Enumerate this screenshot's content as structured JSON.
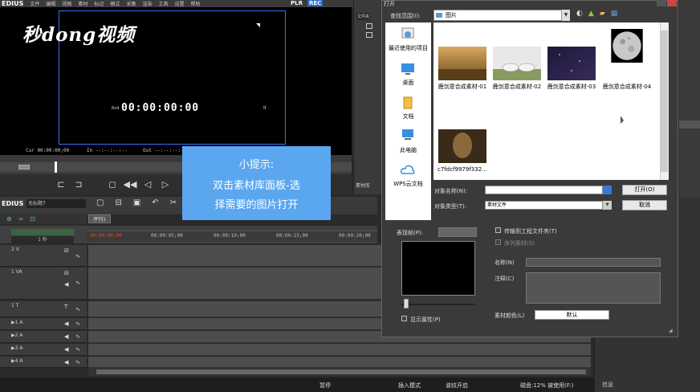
{
  "app": {
    "brand": "EDIUS",
    "menu": [
      "文件",
      "编辑",
      "视图",
      "素材",
      "标记",
      "模式",
      "采集",
      "渲染",
      "工具",
      "设置",
      "帮助"
    ],
    "plr": "PLR",
    "rec": "REC"
  },
  "preview": {
    "logo": "秒dong视频",
    "rec_label": "Rcd",
    "timecode": "00:00:00:00",
    "timecode_suffix": "II",
    "cur": "Cur 00:00:00;00",
    "in": "In --:--:--:--",
    "out": "Out --:--:--:--"
  },
  "bin": {
    "tab": "文件夹",
    "label": "素材库"
  },
  "timeline": {
    "brand": "EDIUS",
    "project_name": "无标题7",
    "sequence_tab": "序列1",
    "ruler_labels": [
      "00:00:00;00",
      "00:00:05;00",
      "00:00:10;00",
      "00:00:15;00",
      "00:00:20;00"
    ],
    "track_ctrl": "1 秒",
    "tracks": [
      {
        "name": "2 V"
      },
      {
        "name": "1 VA"
      },
      {
        "name": "1 T"
      },
      {
        "name": "▶1 A"
      },
      {
        "name": "▶2 A"
      },
      {
        "name": "▶3 A"
      },
      {
        "name": "▶4 A"
      }
    ]
  },
  "status": {
    "pause": "暂停",
    "insert_mode": "插入模式",
    "ripple": "波纹开启",
    "disk": "磁盘:12% 被使用(F:)",
    "info_tab": "信息"
  },
  "tip": {
    "title": "小提示:",
    "line1": "双击素材库面板-选",
    "line2": "择需要的图片打开"
  },
  "dialog": {
    "title": "打开",
    "look_in_label": "查找范围(I):",
    "look_in_value": "图片",
    "places": [
      {
        "label": "最近使用的项目"
      },
      {
        "label": "桌面"
      },
      {
        "label": "文档"
      },
      {
        "label": "此电脑"
      },
      {
        "label": "WPS云文档"
      }
    ],
    "files": [
      {
        "name": "鹿剑意合成素材-01"
      },
      {
        "name": "鹿剑意合成素材-02"
      },
      {
        "name": "鹿剑意合成素材-03"
      },
      {
        "name": "鹿剑意合成素材-04"
      },
      {
        "name": "c7fdcf9979f332..."
      }
    ],
    "filename_label": "对象名称(N):",
    "filename_value": "",
    "filetype_label": "对象类型(T):",
    "filetype_value": "素材文件",
    "open_button": "打开(O)",
    "cancel_button": "取消",
    "preview_label": "表现帧(P):",
    "transfer_label": "传输到工程文件夹(T)",
    "sequence_label": "序列素材(S)",
    "name_label": "名称(N)",
    "note_label": "注释(C)",
    "show_props_label": "显示属性(P)",
    "clip_color_label": "素材颜色(L)",
    "clip_color_value": "默认"
  }
}
